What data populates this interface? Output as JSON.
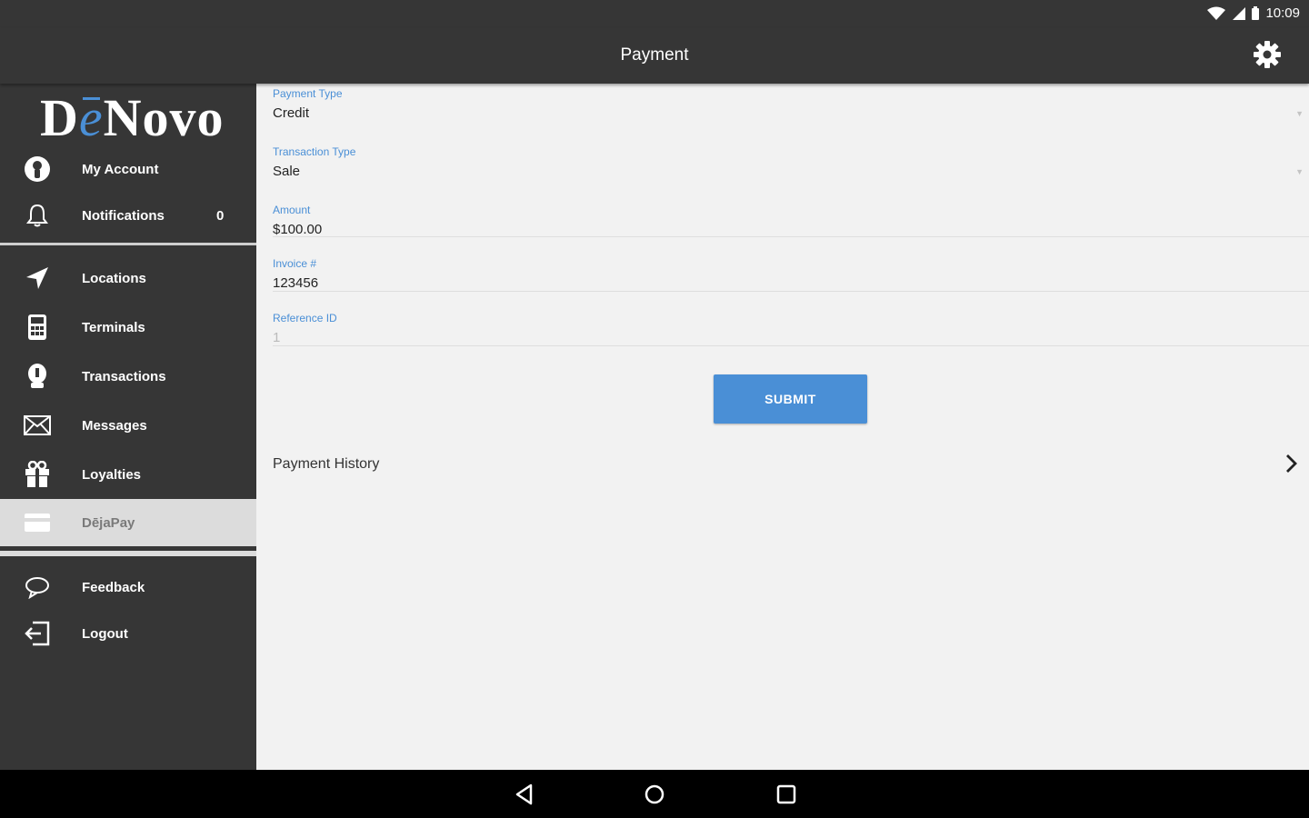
{
  "status_bar": {
    "time": "10:09"
  },
  "app_bar": {
    "title": "Payment"
  },
  "sidebar": {
    "logo": {
      "d": "D",
      "e": "e",
      "rest": "Novo"
    },
    "top_items": [
      {
        "label": "My Account",
        "icon": "account-icon"
      },
      {
        "label": "Notifications",
        "icon": "bell-icon",
        "count": "0"
      }
    ],
    "items": [
      {
        "label": "Locations",
        "icon": "navigation-arrow-icon"
      },
      {
        "label": "Terminals",
        "icon": "terminal-icon"
      },
      {
        "label": "Transactions",
        "icon": "transactions-icon"
      },
      {
        "label": "Messages",
        "icon": "envelope-icon"
      },
      {
        "label": "Loyalties",
        "icon": "gift-icon"
      },
      {
        "label": "DējaPay",
        "icon": "card-icon",
        "active": true
      }
    ],
    "bottom_items": [
      {
        "label": "Feedback",
        "icon": "chat-bubble-icon"
      },
      {
        "label": "Logout",
        "icon": "logout-icon"
      }
    ]
  },
  "form": {
    "payment_type": {
      "label": "Payment Type",
      "value": "Credit"
    },
    "transaction_type": {
      "label": "Transaction Type",
      "value": "Sale"
    },
    "amount": {
      "label": "Amount",
      "value": "$100.00"
    },
    "invoice": {
      "label": "Invoice #",
      "value": "123456"
    },
    "reference": {
      "label": "Reference ID",
      "value": "1"
    },
    "submit_label": "SUBMIT"
  },
  "history": {
    "label": "Payment History"
  },
  "colors": {
    "accent": "#4a8fd6",
    "sidebar_bg": "#363636",
    "content_bg": "#f2f2f2"
  }
}
